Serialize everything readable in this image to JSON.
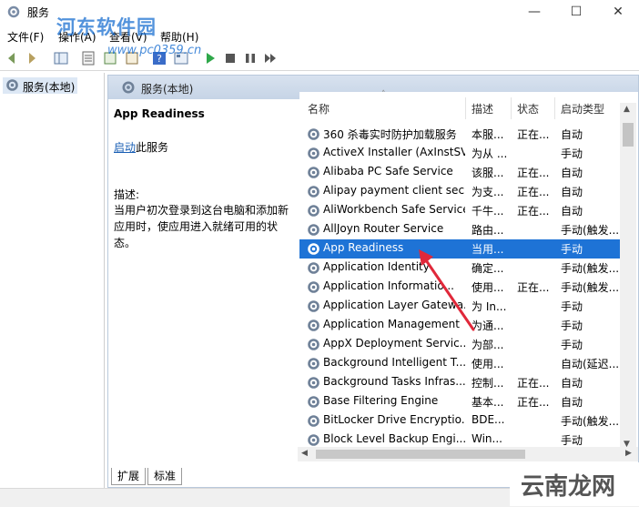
{
  "window": {
    "title": "服务",
    "minimize": "—",
    "maximize": "☐",
    "close": "✕"
  },
  "watermark": {
    "brand": "河东软件园",
    "url": "www.pc0359.cn",
    "corner": "云南龙网"
  },
  "menu": [
    "文件(F)",
    "操作(A)",
    "查看(V)",
    "帮助(H)"
  ],
  "tree": {
    "item": "服务(本地)"
  },
  "content": {
    "header": "服务(本地)"
  },
  "extended": {
    "service_name": "App Readiness",
    "link_text": "启动",
    "link_suffix": "此服务",
    "desc_title": "描述:",
    "desc": "当用户初次登录到这台电脑和添加新应用时，使应用进入就绪可用的状态。"
  },
  "columns": {
    "name": "名称",
    "desc": "描述",
    "status": "状态",
    "startup": "启动类型"
  },
  "services": [
    {
      "name": "360 杀毒实时防护加载服务",
      "desc": "本服...",
      "status": "正在...",
      "startup": "自动"
    },
    {
      "name": "ActiveX Installer (AxInstSV)",
      "desc": "为从 ...",
      "status": "",
      "startup": "手动"
    },
    {
      "name": "Alibaba PC Safe Service",
      "desc": "该服...",
      "status": "正在...",
      "startup": "自动"
    },
    {
      "name": "Alipay payment client sec...",
      "desc": "为支...",
      "status": "正在...",
      "startup": "自动"
    },
    {
      "name": "AliWorkbench Safe Service",
      "desc": "千牛...",
      "status": "正在...",
      "startup": "自动"
    },
    {
      "name": "AllJoyn Router Service",
      "desc": "路由...",
      "status": "",
      "startup": "手动(触发..."
    },
    {
      "name": "App Readiness",
      "desc": "当用...",
      "status": "",
      "startup": "手动"
    },
    {
      "name": "Application Identity",
      "desc": "确定...",
      "status": "",
      "startup": "手动(触发..."
    },
    {
      "name": "Application Informatio...",
      "desc": "使用...",
      "status": "正在...",
      "startup": "手动(触发..."
    },
    {
      "name": "Application Layer Gatewa...",
      "desc": "为 In...",
      "status": "",
      "startup": "手动"
    },
    {
      "name": "Application Management",
      "desc": "为通...",
      "status": "",
      "startup": "手动"
    },
    {
      "name": "AppX Deployment Servic...",
      "desc": "为部...",
      "status": "",
      "startup": "手动"
    },
    {
      "name": "Background Intelligent T...",
      "desc": "使用...",
      "status": "",
      "startup": "自动(延迟..."
    },
    {
      "name": "Background Tasks Infras...",
      "desc": "控制...",
      "status": "正在...",
      "startup": "自动"
    },
    {
      "name": "Base Filtering Engine",
      "desc": "基本...",
      "status": "正在...",
      "startup": "自动"
    },
    {
      "name": "BitLocker Drive Encryptio...",
      "desc": "BDE...",
      "status": "",
      "startup": "手动(触发..."
    },
    {
      "name": "Block Level Backup Engi...",
      "desc": "Win...",
      "status": "",
      "startup": "手动"
    }
  ],
  "selected_index": 6,
  "tabs": [
    "扩展",
    "标准"
  ],
  "colors": {
    "selection": "#1e73d6",
    "link": "#1a5fb4",
    "arrow": "#e0283a"
  }
}
